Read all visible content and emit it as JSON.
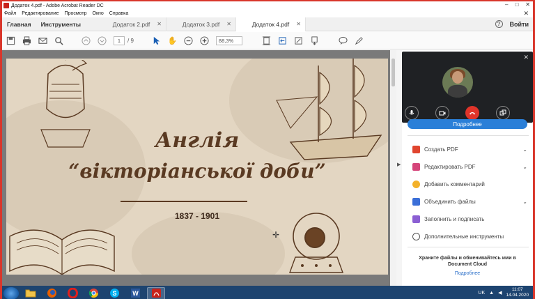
{
  "window": {
    "title": "Додаток 4.pdf - Adobe Acrobat Reader DC",
    "controls": [
      "–",
      "□",
      "✕"
    ]
  },
  "menu": [
    "Файл",
    "Редактирование",
    "Просмотр",
    "Окно",
    "Справка"
  ],
  "tabs": {
    "home": "Главная",
    "tools": "Инструменты",
    "docs": [
      {
        "label": "Додаток 2.pdf",
        "active": false
      },
      {
        "label": "Додаток 3.pdf",
        "active": false
      },
      {
        "label": "Додаток 4.pdf",
        "active": true
      }
    ],
    "help": "?",
    "login": "Войти"
  },
  "toolbar": {
    "page_current": "1",
    "page_total": "/ 9",
    "zoom": "88,3%"
  },
  "slide": {
    "title_line1": "Англія",
    "title_line2": "“вікторіанської доби”",
    "years": "1837 - 1901"
  },
  "right_pane": {
    "more_button": "Подробнее",
    "items": [
      {
        "label": "Создать PDF",
        "color": "#e0452f",
        "expandable": true
      },
      {
        "label": "Редактировать PDF",
        "color": "#d5457a",
        "expandable": true
      },
      {
        "label": "Добавить комментарий",
        "color": "#f3b12a",
        "expandable": false
      },
      {
        "label": "Объединить файлы",
        "color": "#3b6fd8",
        "expandable": true
      },
      {
        "label": "Заполнить и подписать",
        "color": "#8b5fd3",
        "expandable": false
      },
      {
        "label": "Дополнительные инструменты",
        "color": "#555555",
        "expandable": false
      }
    ],
    "cloud_text": "Храните файлы и обменивайтесь ими в Document Cloud",
    "cloud_link": "Подробнее"
  },
  "taskbar": {
    "apps": [
      "explorer-icon",
      "firefox-icon",
      "opera-icon",
      "chrome-icon",
      "skype-icon",
      "word-icon",
      "acrobat-icon"
    ],
    "language": "UK",
    "time": "11:07",
    "date": "14.04.2020"
  }
}
